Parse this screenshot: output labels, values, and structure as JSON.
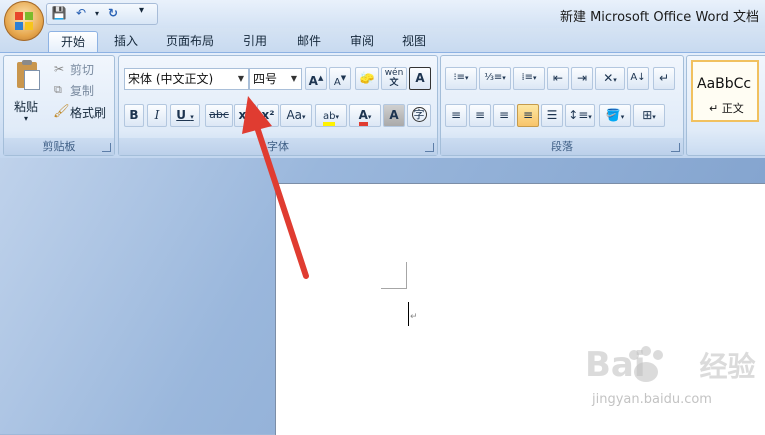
{
  "window": {
    "title": "新建 Microsoft Office Word 文档"
  },
  "qat": {
    "save": "💾",
    "undo": "↶",
    "redo": "↻",
    "more": "▾"
  },
  "tabs": [
    {
      "label": "开始"
    },
    {
      "label": "插入"
    },
    {
      "label": "页面布局"
    },
    {
      "label": "引用"
    },
    {
      "label": "邮件"
    },
    {
      "label": "审阅"
    },
    {
      "label": "视图"
    }
  ],
  "clipboard": {
    "group_label": "剪贴板",
    "paste": "粘贴",
    "cut": "剪切",
    "copy": "复制",
    "format_painter": "格式刷"
  },
  "font": {
    "group_label": "字体",
    "font_name": "宋体 (中文正文)",
    "font_size": "四号",
    "bold": "B",
    "italic": "I",
    "underline": "U",
    "strike": "abc",
    "subscript": "x₂",
    "superscript": "x²",
    "change_case": "Aa",
    "grow": "A",
    "shrink": "A",
    "phonetic": "wén",
    "border_char": "A",
    "shade_char": "A",
    "enclose": "字"
  },
  "paragraph": {
    "group_label": "段落"
  },
  "styles": {
    "preview": "AaBbCc",
    "name": "↵ 正文"
  },
  "watermark": {
    "brand": "Bai",
    "brand2": "经验",
    "url": "jingyan.baidu.com"
  },
  "colors": {
    "accent_red": "#e03c31",
    "highlight_yellow": "#fff200"
  }
}
